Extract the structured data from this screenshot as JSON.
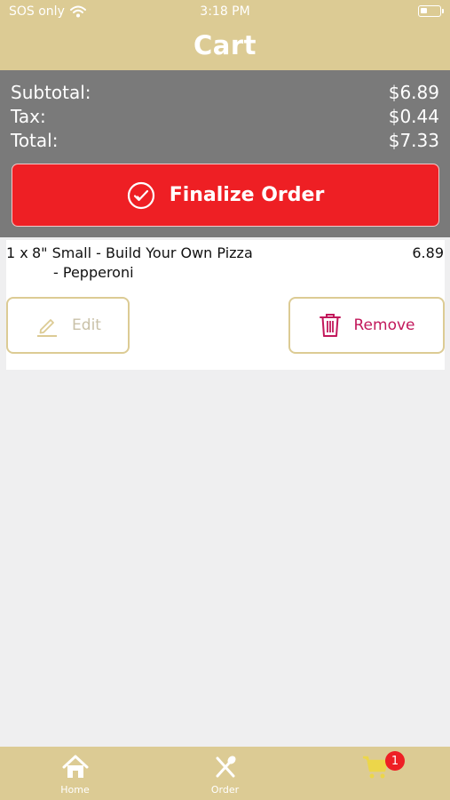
{
  "status_bar": {
    "carrier": "SOS only",
    "time": "3:18 PM"
  },
  "header": {
    "title": "Cart"
  },
  "summary": {
    "subtotal_label": "Subtotal:",
    "subtotal_value": "$6.89",
    "tax_label": "Tax:",
    "tax_value": "$0.44",
    "total_label": "Total:",
    "total_value": "$7.33",
    "finalize_label": "Finalize Order"
  },
  "cart_items": [
    {
      "qty": "1 x",
      "name": "8\" Small - Build Your Own Pizza",
      "modifier": "- Pepperoni",
      "price": "6.89",
      "edit_label": "Edit",
      "remove_label": "Remove"
    }
  ],
  "tabbar": {
    "home_label": "Home",
    "order_label": "Order",
    "cart_badge": "1"
  },
  "colors": {
    "header_bg": "#dccb94",
    "summary_bg": "#7a7a7a",
    "accent_red": "#ee1f24",
    "remove_text": "#c2185b"
  },
  "icons": [
    "wifi-icon",
    "battery-icon",
    "check-circle-icon",
    "pencil-icon",
    "trash-icon",
    "home-icon",
    "fork-knife-icon",
    "cart-icon"
  ]
}
